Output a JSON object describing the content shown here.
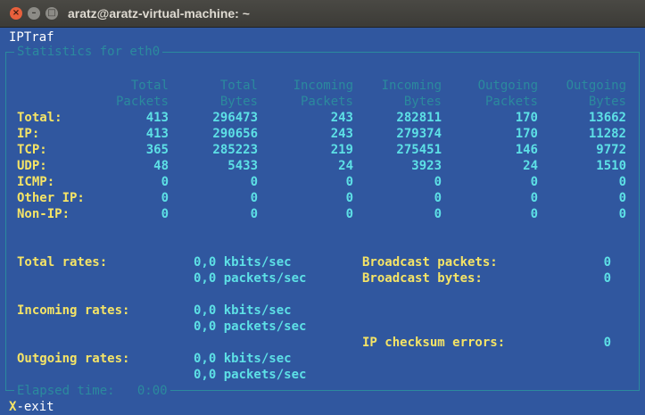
{
  "window": {
    "title": "aratz@aratz-virtual-machine: ~",
    "close": "×",
    "minimize": "–",
    "maximize": "□"
  },
  "app": {
    "name": "IPTraf",
    "panel_title": "Statistics for eth0"
  },
  "headers": {
    "total_packets": [
      "Total",
      "Packets"
    ],
    "total_bytes": [
      "Total",
      "Bytes"
    ],
    "incoming_packets": [
      "Incoming",
      "Packets"
    ],
    "incoming_bytes": [
      "Incoming",
      "Bytes"
    ],
    "outgoing_packets": [
      "Outgoing",
      "Packets"
    ],
    "outgoing_bytes": [
      "Outgoing",
      "Bytes"
    ]
  },
  "rows": [
    {
      "label": "Total:",
      "values": [
        "413",
        "296473",
        "243",
        "282811",
        "170",
        "13662"
      ]
    },
    {
      "label": "IP:",
      "values": [
        "413",
        "290656",
        "243",
        "279374",
        "170",
        "11282"
      ]
    },
    {
      "label": "TCP:",
      "values": [
        "365",
        "285223",
        "219",
        "275451",
        "146",
        "9772"
      ]
    },
    {
      "label": "UDP:",
      "values": [
        "48",
        "5433",
        "24",
        "3923",
        "24",
        "1510"
      ]
    },
    {
      "label": "ICMP:",
      "values": [
        "0",
        "0",
        "0",
        "0",
        "0",
        "0"
      ]
    },
    {
      "label": "Other IP:",
      "values": [
        "0",
        "0",
        "0",
        "0",
        "0",
        "0"
      ]
    },
    {
      "label": "Non-IP:",
      "values": [
        "0",
        "0",
        "0",
        "0",
        "0",
        "0"
      ]
    }
  ],
  "rates": {
    "total_label": "Total rates:",
    "total_kbits": "0,0 kbits/sec",
    "total_packets": "0,0 packets/sec",
    "incoming_label": "Incoming rates:",
    "incoming_kbits": "0,0 kbits/sec",
    "incoming_packets": "0,0 packets/sec",
    "outgoing_label": "Outgoing rates:",
    "outgoing_kbits": "0,0 kbits/sec",
    "outgoing_packets": "0,0 packets/sec"
  },
  "broadcast": {
    "packets_label": "Broadcast packets:",
    "packets_value": "0",
    "bytes_label": "Broadcast bytes:",
    "bytes_value": "0",
    "checksum_label": "IP checksum errors:",
    "checksum_value": "0"
  },
  "footer": {
    "elapsed_label": "Elapsed time:",
    "elapsed_value": "0:00",
    "exit_key": "X",
    "exit_text": "-exit"
  }
}
